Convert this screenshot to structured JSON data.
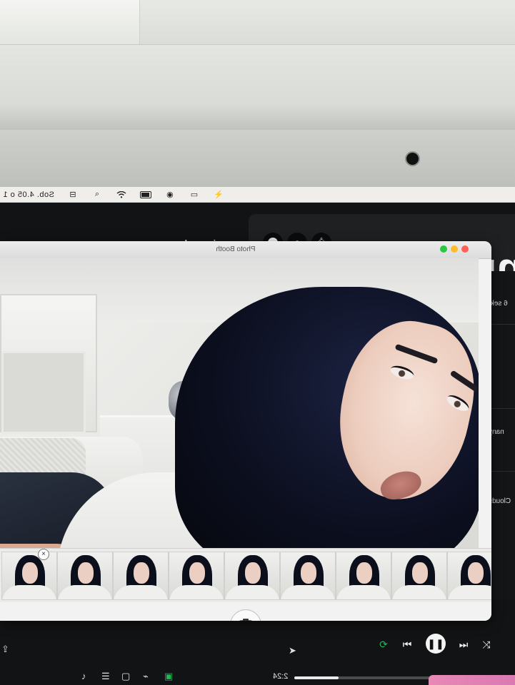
{
  "menubar": {
    "clock": "Sob. 4.05 o 1",
    "icons": [
      "control-center-icon",
      "search-icon",
      "wifi-icon",
      "battery-icon",
      "play-icon",
      "screen-mirror-icon",
      "do-not-disturb-icon"
    ]
  },
  "player": {
    "top_icons": [
      "profile-icon",
      "friends-icon",
      "bell-icon"
    ],
    "header_partial": "nn",
    "song_title": "scrim n ruby",
    "side_texts": [
      "6 sek.",
      "nany",
      "Clouds"
    ],
    "elapsed": "2:24",
    "progress_fraction": 0.2,
    "controls": [
      "shuffle-icon",
      "next-icon",
      "pause-icon",
      "previous-icon",
      "repeat-icon"
    ]
  },
  "photobooth": {
    "title": "Photo Booth",
    "traffic_lights": [
      "#ff5f57",
      "#febc2e",
      "#28c840"
    ],
    "thumbnail_count": 9,
    "close_glyph": "×",
    "shutter_icon": "camera-icon"
  },
  "colors": {
    "accent_green": "#1db954",
    "screen_bg": "#121314"
  }
}
